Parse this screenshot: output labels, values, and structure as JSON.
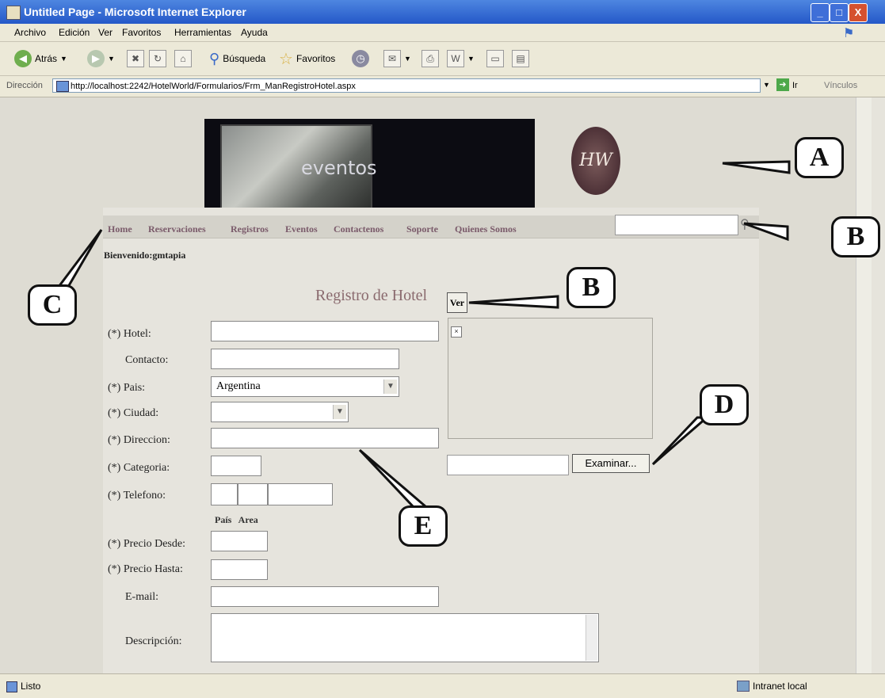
{
  "window": {
    "title": "Untitled Page - Microsoft Internet Explorer",
    "controls": [
      "_",
      "□",
      "X"
    ]
  },
  "menu": [
    "Archivo",
    "Edición",
    "Ver",
    "Favoritos",
    "Herramientas",
    "Ayuda"
  ],
  "toolbar": {
    "back_label": "Atrás",
    "search_label": "Búsqueda",
    "favorites_label": "Favoritos"
  },
  "address": {
    "label": "Dirección",
    "url": "http://localhost:2242/HotelWorld/Formularios/Frm_ManRegistroHotel.aspx",
    "go_label": "Ir",
    "links_label": "Vínculos"
  },
  "banner": {
    "text": "eventos",
    "logo_text": "HW"
  },
  "nav": {
    "items": [
      "Home",
      "Reservaciones",
      "Registros",
      "Eventos",
      "Contactenos",
      "Soporte",
      "Quienes Somos"
    ]
  },
  "welcome": "Bienvenido:gmtapia",
  "form": {
    "title": "Registro de Hotel",
    "ver_label": "Ver",
    "browse_label": "Examinar...",
    "broken_image": "×",
    "labels": {
      "hotel": "(*) Hotel:",
      "contacto": "Contacto:",
      "pais": "(*) Pais:",
      "ciudad": "(*) Ciudad:",
      "direccion": "(*) Direccion:",
      "categoria": "(*) Categoria:",
      "telefono": "(*) Telefono:",
      "phone_sub": "País   Area",
      "precio_desde": "(*) Precio Desde:",
      "precio_hasta": "(*) Precio Hasta:",
      "email": "E-mail:",
      "descripcion": "Descripción:"
    },
    "values": {
      "pais": "Argentina",
      "ciudad": ""
    }
  },
  "callouts": [
    "A",
    "B",
    "B",
    "C",
    "D",
    "E"
  ],
  "status": {
    "left": "Listo",
    "zone": "Intranet local"
  }
}
